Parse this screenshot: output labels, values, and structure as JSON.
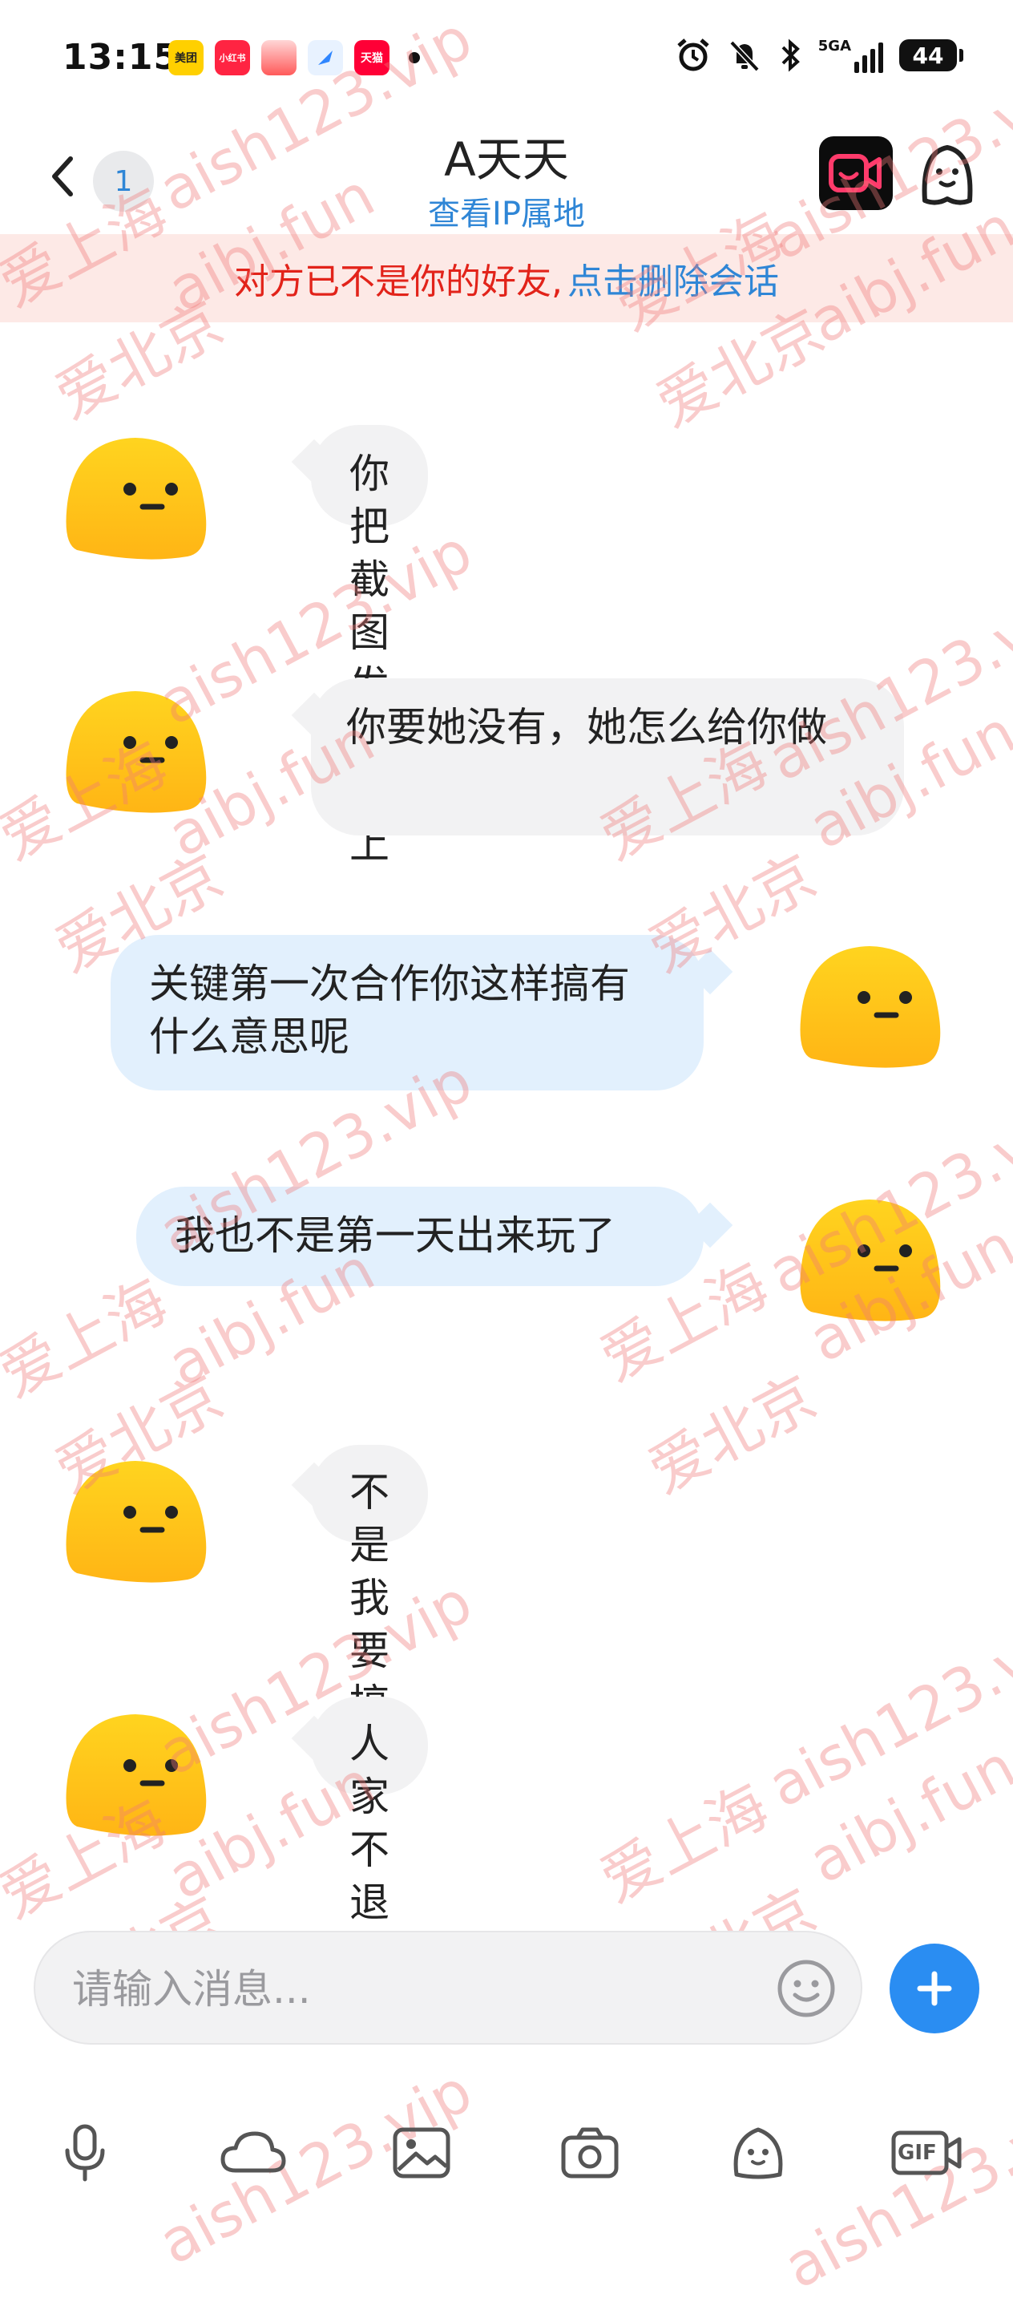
{
  "status_bar": {
    "time": "13:15",
    "apps": [
      {
        "name": "美团",
        "color": "#ffd000",
        "text_color": "#222"
      },
      {
        "name": "小红书",
        "color": "#ff2442",
        "text_color": "#ffffff"
      },
      {
        "name": "app3",
        "color": "#ff5a5a",
        "text_color": "#ffffff"
      },
      {
        "name": "app4",
        "color": "#2f86ff",
        "text_color": "#ffffff"
      },
      {
        "name": "天猫",
        "color": "#ff0036",
        "text_color": "#ffffff"
      }
    ],
    "network": "5GA",
    "battery": "44"
  },
  "header": {
    "unread_count": "1",
    "title": "A天天",
    "subtitle": "查看IP属地"
  },
  "notice": {
    "text": "对方已不是你的好友,",
    "link": "点击删除会话"
  },
  "messages": [
    {
      "side": "left",
      "text": "你把截图发论坛上"
    },
    {
      "side": "left",
      "text": "你要她没有，她怎么给你做"
    },
    {
      "side": "right",
      "text": "关键第一次合作你这样搞有什么意思呢"
    },
    {
      "side": "right",
      "text": "我也不是第一天出来玩了"
    },
    {
      "side": "left",
      "text": "不是我要搞啊"
    },
    {
      "side": "left",
      "text": "人家不退"
    }
  ],
  "composer": {
    "placeholder": "请输入消息..."
  },
  "toolbar": {
    "items": [
      "voice",
      "cloud",
      "image",
      "camera",
      "sticker",
      "gif"
    ],
    "gif_label": "GIF"
  },
  "watermark": {
    "line1": "aish123.vip",
    "line2": "aibj.fun",
    "shanghai": "爱上海",
    "beijing": "爱北京"
  },
  "colors": {
    "accent": "#2f86d6",
    "plus_button": "#2a8df2",
    "notice_bg": "#fde9e6",
    "notice_text": "#e2231a",
    "bubble_left": "#f2f2f3",
    "bubble_right": "#e2f0fd",
    "avatar_yellow": "#ffc61a"
  }
}
